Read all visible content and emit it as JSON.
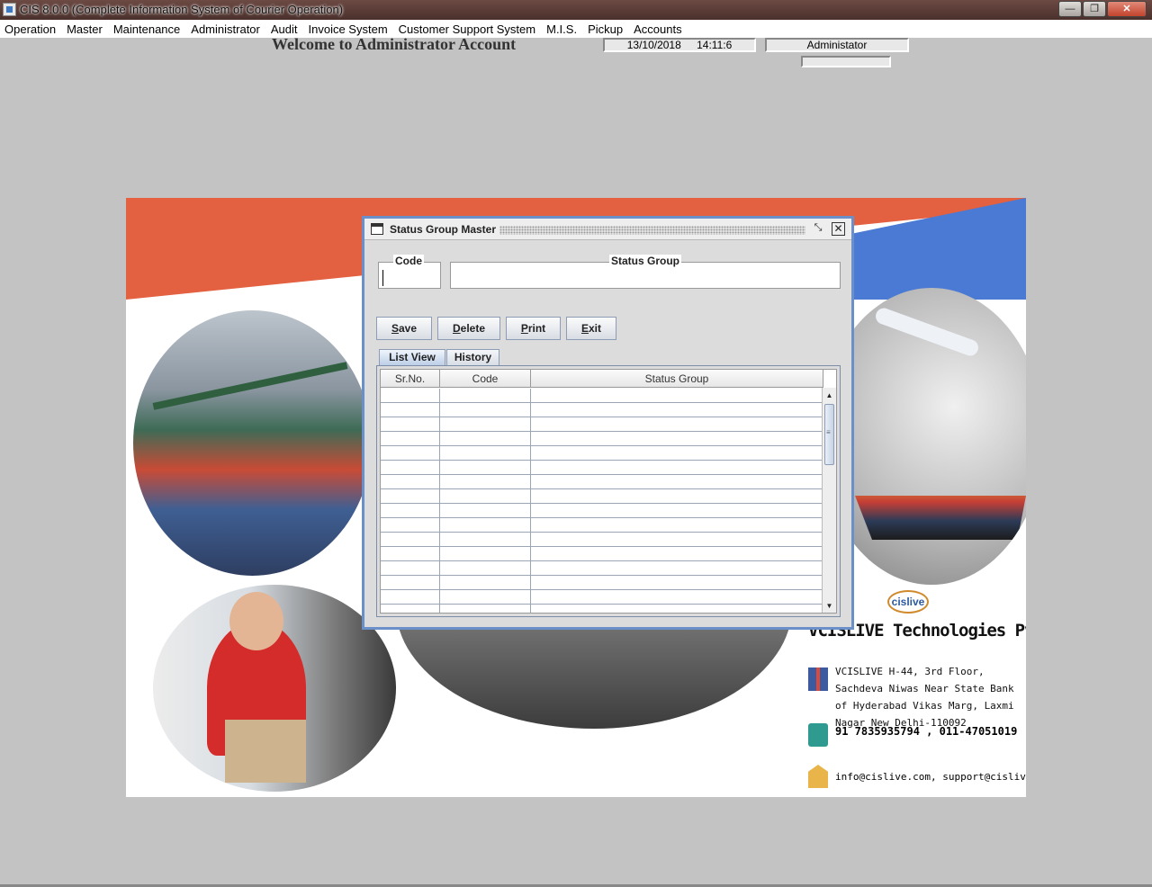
{
  "window": {
    "title": "CIS 8.0.0 (Complete Information System of Courier Operation)",
    "min_label": "—",
    "restore_label": "❐",
    "close_label": "✕"
  },
  "menu": [
    "Operation",
    "Master",
    "Maintenance",
    "Administrator",
    "Audit",
    "Invoice System",
    "Customer Support System",
    "M.I.S.",
    "Pickup",
    "Accounts"
  ],
  "header": {
    "welcome": "Welcome to Administrator Account",
    "date": "13/10/2018",
    "time": "14:11:6",
    "user": "Administator"
  },
  "company": {
    "logo": "cislive",
    "name": "VCISLIVE Technologies Pvt Ltd",
    "address": "VCISLIVE H-44, 3rd Floor, Sachdeva Niwas Near State Bank of Hyderabad Vikas Marg, Laxmi Nagar New Delhi-110092",
    "phone": "91 7835935794 , 011-47051019",
    "email": "info@cislive.com, support@cislive.com"
  },
  "dialog": {
    "title": "Status Group Master",
    "code_label": "Code",
    "code_value": "",
    "group_label": "Status Group",
    "group_value": "",
    "buttons": {
      "save": "Save",
      "delete": "Delete",
      "print": "Print",
      "exit": "Exit"
    },
    "tabs": {
      "list": "List View",
      "history": "History"
    },
    "columns": [
      "Sr.No.",
      "Code",
      "Status Group"
    ],
    "max_label": "⤡",
    "close_label": "✕"
  },
  "colors": {
    "frame_border": "#6b8fc9",
    "title_bar": "#4a302b",
    "banner_red": "#e36040",
    "banner_blue": "#4a7ad4"
  }
}
